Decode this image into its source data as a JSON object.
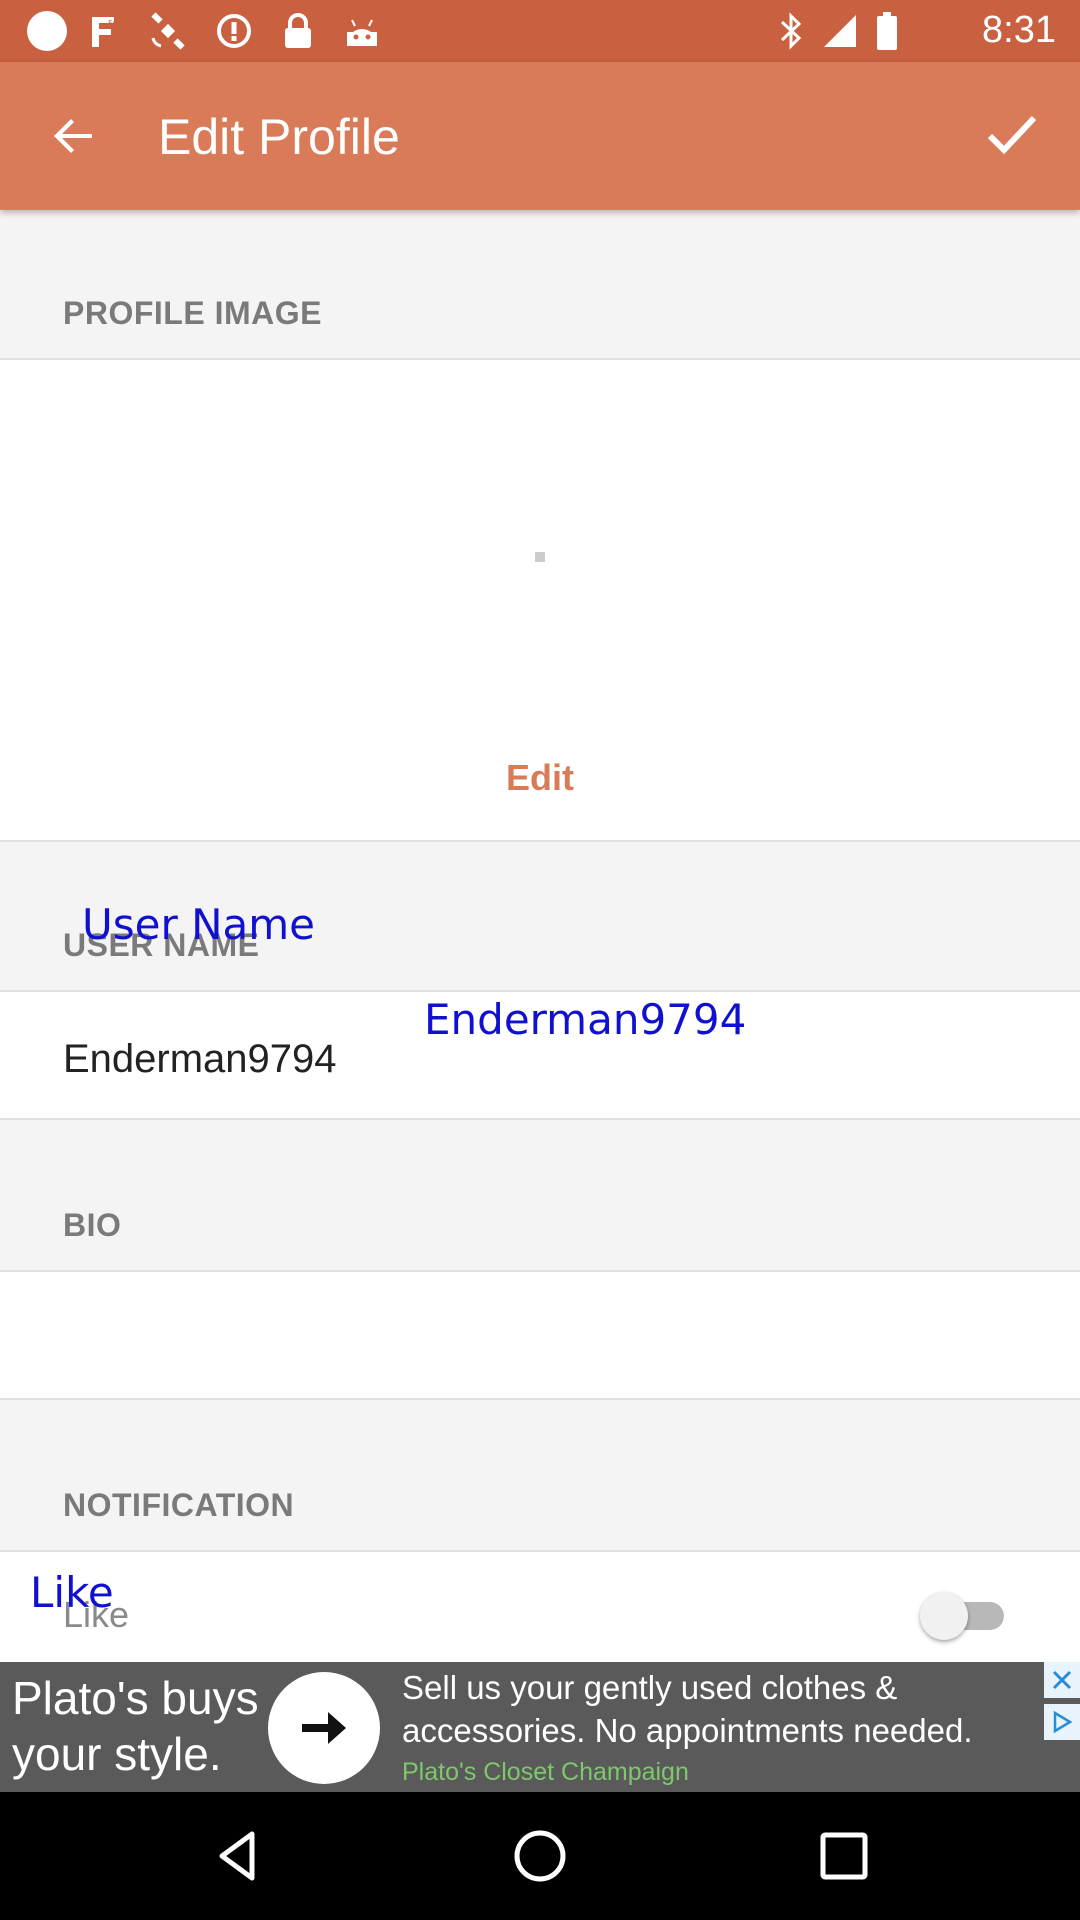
{
  "status_bar": {
    "time": "8:31",
    "icons": [
      "circle-icon",
      "fake-gps-icon",
      "satellite-icon",
      "alert-icon",
      "lock-icon",
      "android-icon",
      "bluetooth-icon",
      "signal-icon",
      "battery-icon"
    ]
  },
  "app_bar": {
    "title": "Edit Profile",
    "back_icon": "arrow-back-icon",
    "confirm_icon": "check-icon"
  },
  "sections": {
    "profile_image": "PROFILE IMAGE",
    "user_name": "USER NAME",
    "bio": "BIO",
    "notification": "NOTIFICATION"
  },
  "profile_image": {
    "edit_label": "Edit"
  },
  "user_name": {
    "value": "Enderman9794"
  },
  "bio": {
    "value": ""
  },
  "notification": {
    "like_label": "Like",
    "like_enabled": false
  },
  "overlays": {
    "user_name_label": "User Name",
    "user_name_value": "Enderman9794",
    "like_label": "Like"
  },
  "ad": {
    "left_text": "Plato's buys your style.",
    "headline": "Sell us your gently used clothes & accessories. No appointments needed.",
    "sponsor": "Plato's Closet Champaign",
    "colors": {
      "sponsor": "#7ec86c",
      "background": "#5a5a5a"
    }
  },
  "nav_bar": {
    "buttons": [
      "back-triangle-icon",
      "home-circle-icon",
      "recents-square-icon"
    ]
  },
  "colors": {
    "status_bar": "#c9603f",
    "app_bar": "#d97b58",
    "accent": "#d97b58",
    "section_bg": "#f4f4f4"
  }
}
